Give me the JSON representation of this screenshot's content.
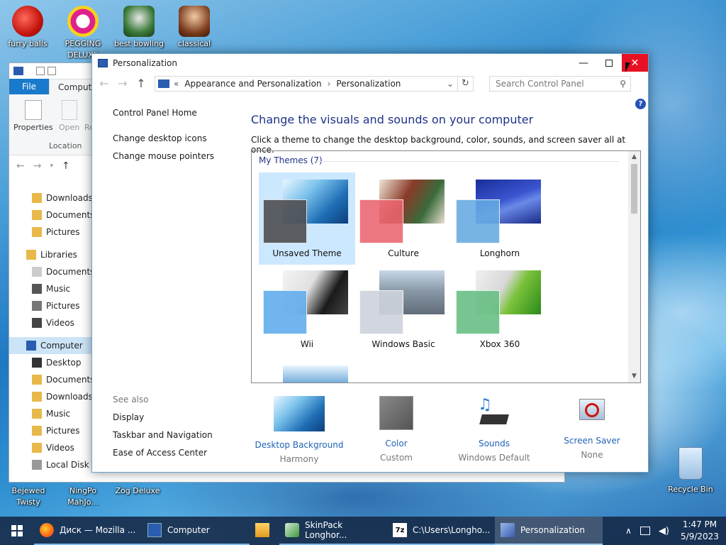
{
  "desktop": {
    "icons": [
      {
        "label": "furry balls"
      },
      {
        "label": "PEGGING DELUXE"
      },
      {
        "label": "best bowling"
      },
      {
        "label": "classical"
      },
      {
        "label": "Bejewed Twisty"
      },
      {
        "label": "NingPo MahJo..."
      },
      {
        "label": "Zog Deluxe"
      },
      {
        "label": "Recycle Bin"
      }
    ]
  },
  "explorer": {
    "tab_file": "File",
    "tab_computer": "Computer",
    "ribbon": {
      "properties": "Properties",
      "open": "Open",
      "rename_partial": "Re",
      "group_location": "Location"
    },
    "tree": [
      {
        "label": "Downloads"
      },
      {
        "label": "Documents"
      },
      {
        "label": "Pictures"
      },
      {
        "label": "Libraries"
      },
      {
        "label": "Documents"
      },
      {
        "label": "Music"
      },
      {
        "label": "Pictures"
      },
      {
        "label": "Videos"
      },
      {
        "label": "Computer"
      },
      {
        "label": "Desktop"
      },
      {
        "label": "Documents"
      },
      {
        "label": "Downloads"
      },
      {
        "label": "Music"
      },
      {
        "label": "Pictures"
      },
      {
        "label": "Videos"
      },
      {
        "label": "Local Disk"
      }
    ]
  },
  "window": {
    "title": "Personalization",
    "address": {
      "prefix": "«",
      "crumb1": "Appearance and Personalization",
      "crumb2": "Personalization"
    },
    "search_placeholder": "Search Control Panel",
    "left_links": [
      "Control Panel Home",
      "Change desktop icons",
      "Change mouse pointers"
    ],
    "see_also": {
      "header": "See also",
      "links": [
        "Display",
        "Taskbar and Navigation",
        "Ease of Access Center"
      ]
    },
    "heading": "Change the visuals and sounds on your computer",
    "subheading": "Click a theme to change the desktop background, color, sounds, and screen saver all at once.",
    "group_header": "My Themes (7)",
    "themes": [
      {
        "name": "Unsaved Theme",
        "selected": true
      },
      {
        "name": "Culture",
        "selected": false
      },
      {
        "name": "Longhorn",
        "selected": false
      },
      {
        "name": "Wii",
        "selected": false
      },
      {
        "name": "Windows Basic",
        "selected": false
      },
      {
        "name": "Xbox 360",
        "selected": false
      }
    ],
    "bottom": [
      {
        "title": "Desktop Background",
        "sub": "Harmony"
      },
      {
        "title": "Color",
        "sub": "Custom"
      },
      {
        "title": "Sounds",
        "sub": "Windows Default"
      },
      {
        "title": "Screen Saver",
        "sub": "None"
      }
    ]
  },
  "taskbar": {
    "items": [
      {
        "label": "Диск — Mozilla ..."
      },
      {
        "label": "Computer"
      },
      {
        "label": "SkinPack Longhor..."
      },
      {
        "label": "C:\\Users\\Longho..."
      },
      {
        "label": "Personalization"
      }
    ],
    "time": "1:47 PM",
    "date": "5/9/2023"
  },
  "colors": {
    "accent": "#1e3287",
    "link": "#1f63b5",
    "close": "#e81123",
    "selection": "#cce8ff"
  }
}
